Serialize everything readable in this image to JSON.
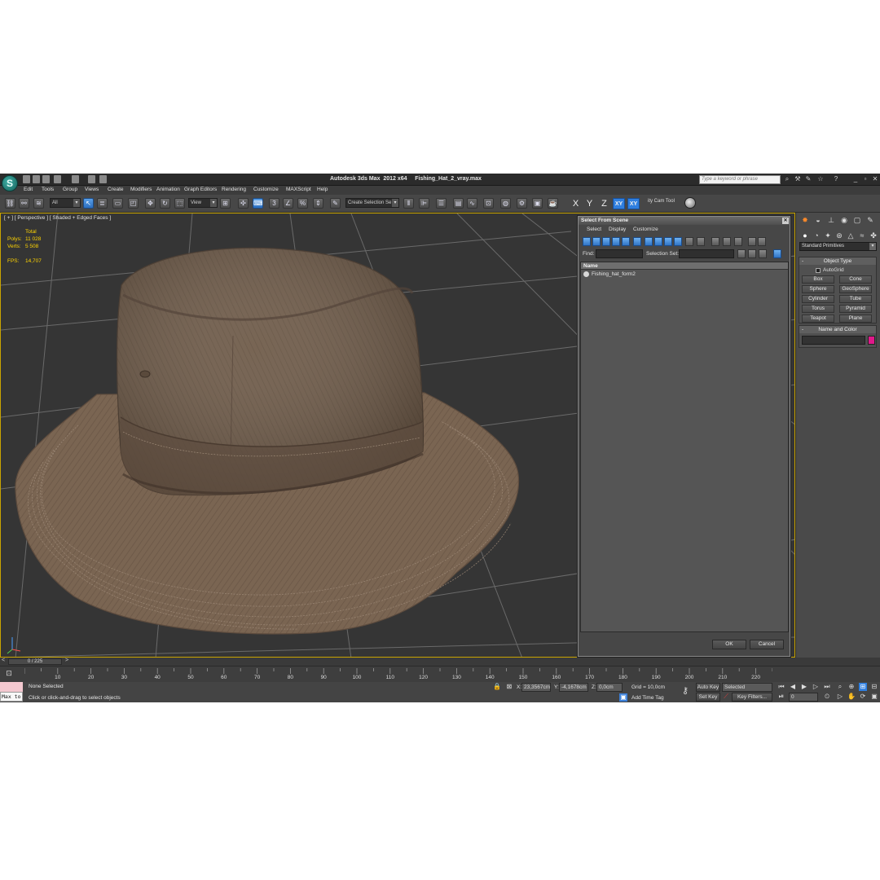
{
  "titlebar": {
    "logo": "3ds-max-logo",
    "title": "Autodesk 3ds Max  2012 x64     Fishing_Hat_2_vray.max",
    "search_placeholder": "Type a keyword or phrase"
  },
  "menu": [
    "Edit",
    "Tools",
    "Group",
    "Views",
    "Create",
    "Modifiers",
    "Animation",
    "Graph Editors",
    "Rendering",
    "Customize",
    "MAXScript",
    "Help"
  ],
  "toolbar": {
    "filter_value": "All",
    "ref_coord_value": "View",
    "selection_set_value": "Create Selection Se",
    "axes": [
      "X",
      "Y",
      "Z",
      "XY",
      "XY"
    ],
    "cam_tool_label": "ity Cam Tool"
  },
  "viewport": {
    "label": "[ + ] [ Perspective ] [ Shaded + Edged Faces ]",
    "stats": {
      "header": "Total",
      "polys_label": "Polys:",
      "polys": "11 028",
      "verts_label": "Verts:",
      "verts": "5 508",
      "fps_label": "FPS:",
      "fps": "14,707"
    },
    "colors": {
      "hat": "#7a6552",
      "grid_bg": "#353535",
      "selection_border": "#c9a400"
    }
  },
  "dialog": {
    "title": "Select From Scene",
    "menu": [
      "Select",
      "Display",
      "Customize"
    ],
    "find_label": "Find:",
    "selection_set_label": "Selection Set:",
    "column_header": "Name",
    "items": [
      "Fishing_hat_form2"
    ],
    "ok_label": "OK",
    "cancel_label": "Cancel"
  },
  "command_panel": {
    "dropdown": "Standard Primitives",
    "object_type_title": "Object Type",
    "autogrid_label": "AutoGrid",
    "primitives": [
      "Box",
      "Cone",
      "Sphere",
      "GeoSphere",
      "Cylinder",
      "Tube",
      "Torus",
      "Pyramid",
      "Teapot",
      "Plane"
    ],
    "name_color_title": "Name and Color",
    "object_color": "#e0188a"
  },
  "timeline": {
    "slider_label": "0 / 225",
    "ticks": [
      "10",
      "20",
      "30",
      "40",
      "50",
      "60",
      "70",
      "80",
      "90",
      "100",
      "110",
      "120",
      "130",
      "140",
      "150",
      "160",
      "170",
      "180",
      "190",
      "200",
      "210",
      "220"
    ]
  },
  "status": {
    "maxscript_value": "Max to",
    "selection": "None Selected",
    "prompt": "Click or click-and-drag to select objects",
    "x_label": "X:",
    "x_value": "23,3567cm",
    "y_label": "Y:",
    "y_value": "-4,1678cm",
    "z_label": "Z:",
    "z_value": "0,0cm",
    "grid": "Grid = 10,0cm",
    "add_time_tag": "Add Time Tag",
    "auto_key": "Auto Key",
    "set_key": "Set Key",
    "key_mode_value": "Selected",
    "key_filters": "Key Filters...",
    "frame_value": "0"
  }
}
